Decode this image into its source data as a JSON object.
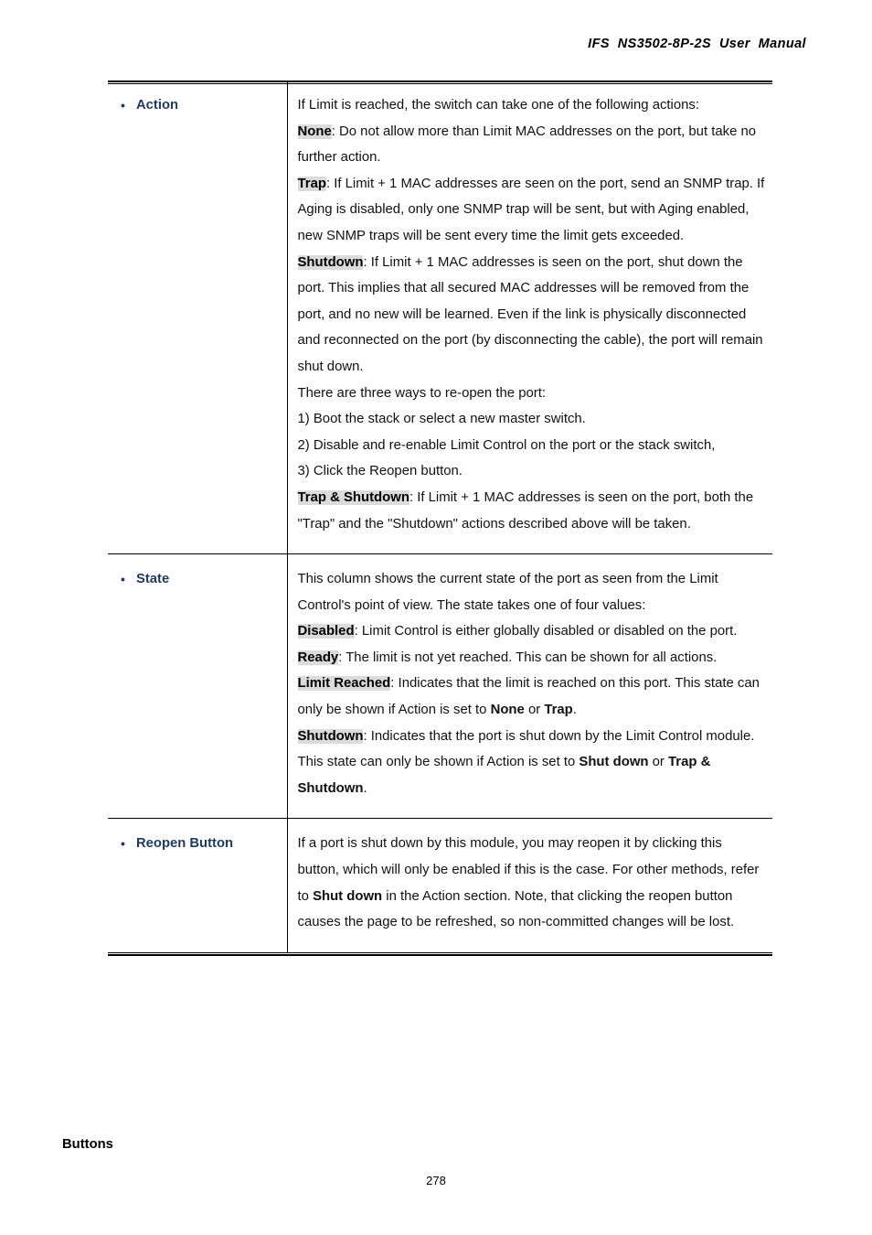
{
  "header": {
    "title": "IFS  NS3502-8P-2S  User  Manual"
  },
  "footer": {
    "buttons_heading": "Buttons",
    "page_number": "278"
  },
  "colors": {
    "label_blue": "#1F3A5F",
    "keyword_highlight": "#DBDBDB",
    "rule_black": "#000000"
  },
  "table": {
    "rows": [
      {
        "label": "Action",
        "bullet": "•",
        "description": {
          "intro": "If Limit is reached, the switch can take one of the following actions:",
          "items": [
            {
              "keyword": "None",
              "text": ": Do not allow more than Limit MAC addresses on the port, but take no further action."
            },
            {
              "keyword": "Trap",
              "text": ": If Limit + 1 MAC addresses are seen on the port, send an SNMP trap. If Aging is disabled, only one SNMP trap will be sent, but with Aging enabled, new SNMP traps will be sent every time the limit gets exceeded."
            },
            {
              "keyword": "Shutdown",
              "text": ": If Limit + 1 MAC addresses is seen on the port, shut down the port. This implies that all secured MAC addresses will be removed from the port, and no new will be learned. Even if the link is physically disconnected and reconnected on the port (by disconnecting the cable), the port will remain shut down."
            }
          ],
          "reopen_intro": "There are three ways to re-open the port:",
          "reopen_steps": [
            "1) Boot the stack or select a new master switch.",
            "2) Disable and re-enable Limit Control on the port or the stack switch,",
            "3) Click the Reopen button."
          ],
          "final": {
            "keyword": "Trap & Shutdown",
            "text": ": If Limit + 1 MAC addresses is seen on the port, both the \"Trap\" and the \"Shutdown\" actions described above will be taken."
          }
        }
      },
      {
        "label": "State",
        "bullet": "•",
        "description": {
          "intro": "This column shows the current state of the port as seen from the Limit Control's point of view. The state takes one of four values:",
          "items": [
            {
              "keyword": "Disabled",
              "text": ": Limit Control is either globally disabled or disabled on the port."
            },
            {
              "keyword": "Ready",
              "text": ": The limit is not yet reached. This can be shown for all actions."
            },
            {
              "keyword": "Limit Reached",
              "text_before": ": Indicates that the limit is reached on this port. This state can only be shown if Action is set to ",
              "bold_a": "None",
              "text_mid": " or ",
              "bold_b": "Trap",
              "text_after": "."
            },
            {
              "keyword": "Shutdown",
              "text_before": ": Indicates that the port is shut down by the Limit Control module. This state can only be shown if Action is set to ",
              "bold_a": "Shut down",
              "text_mid": " or ",
              "bold_b": "Trap & Shutdown",
              "text_after": "."
            }
          ]
        }
      },
      {
        "label": "Reopen Button",
        "bullet": "•",
        "description": {
          "text_before": "If a port is shut down by this module, you may reopen it by clicking this button, which will only be enabled if this is the case. For other methods, refer to ",
          "bold_a": "Shut down",
          "text_after": " in the Action section. Note, that clicking the reopen button causes the page to be refreshed, so non-committed changes will be lost."
        }
      }
    ]
  }
}
